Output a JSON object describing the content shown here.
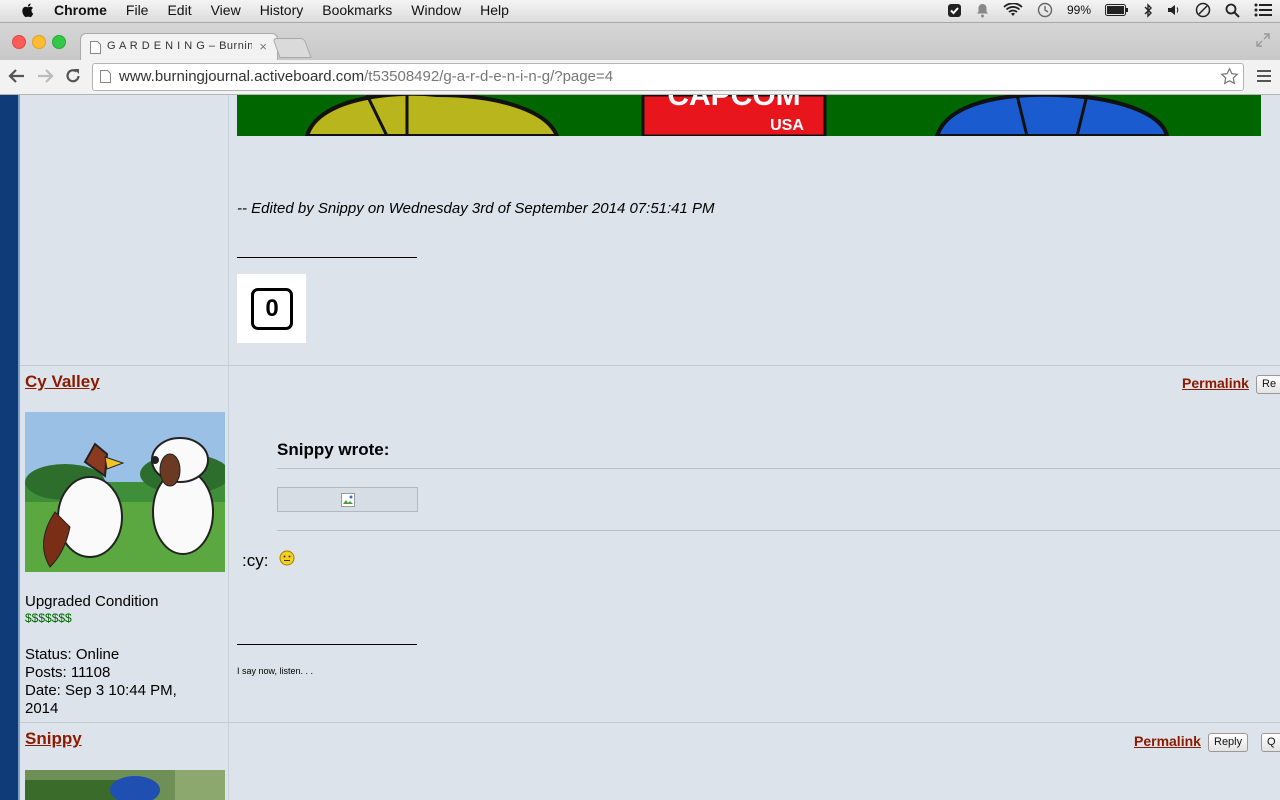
{
  "menubar": {
    "app": "Chrome",
    "items": [
      "File",
      "Edit",
      "View",
      "History",
      "Bookmarks",
      "Window",
      "Help"
    ],
    "battery": "99%"
  },
  "browser": {
    "tab_title": "G A R D E N I N G – Burning",
    "url_host": "www.burningjournal.activeboard.com",
    "url_path": "/t53508492/g-a-r-d-e-n-i-n-g/?page=4"
  },
  "post1": {
    "banner_text": "CAPCOM",
    "banner_sub": "USA",
    "edited": "-- Edited by Snippy on Wednesday 3rd of September 2014 07:51:41 PM",
    "sig_badge": "0"
  },
  "post2": {
    "username": "Cy Valley",
    "permalink": "Permalink",
    "reply_btn": "Re",
    "quote_header": "Snippy wrote:",
    "body_text": ":cy:",
    "rank": "Upgraded Condition",
    "rank_stars": "$$$$$$$",
    "status": "Status: Online",
    "posts": "Posts: 11108",
    "date": "Date: Sep 3 10:44 PM,",
    "date2": "2014",
    "signature": "I say now, listen. . ."
  },
  "post3": {
    "username": "Snippy",
    "permalink": "Permalink",
    "reply_btn": "Reply",
    "quote_btn": "Q"
  },
  "colors": {
    "link": "#8b1a00",
    "page_bg": "#dce3ea",
    "sidebar": "#0f3b78",
    "banner_green": "#006600",
    "banner_red": "#e8161c"
  }
}
